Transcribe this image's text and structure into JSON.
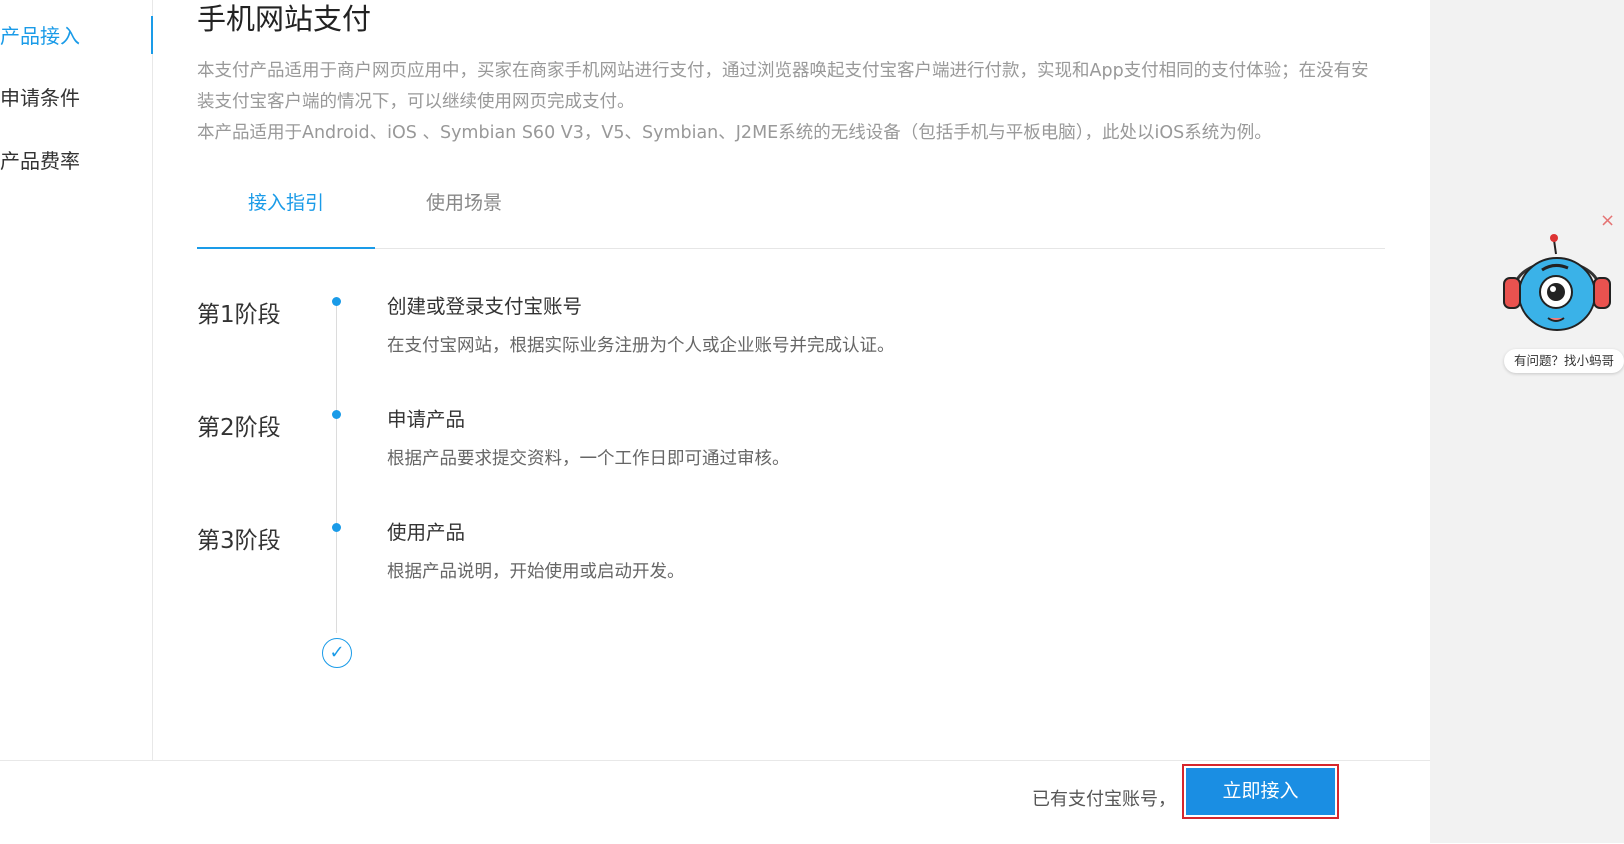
{
  "sidebar": {
    "items": [
      {
        "label": "产品接入",
        "active": true
      },
      {
        "label": "申请条件",
        "active": false
      },
      {
        "label": "产品费率",
        "active": false
      }
    ]
  },
  "main": {
    "title": "手机网站支付",
    "description_lines": [
      "本支付产品适用于商户网页应用中，买家在商家手机网站进行支付，通过浏览器唤起支付宝客户端进行付款，实现和App支付相同的支付体验；在没有安",
      "装支付宝客户端的情况下，可以继续使用网页完成支付。",
      "本产品适用于Android、iOS 、Symbian S60 V3，V5、Symbian、J2ME系统的无线设备（包括手机与平板电脑），此处以iOS系统为例。"
    ],
    "tabs": [
      {
        "label": "接入指引",
        "active": true
      },
      {
        "label": "使用场景",
        "active": false
      }
    ],
    "stages": [
      {
        "label": "第1阶段",
        "title": "创建或登录支付宝账号",
        "desc": "在支付宝网站，根据实际业务注册为个人或企业账号并完成认证。"
      },
      {
        "label": "第2阶段",
        "title": "申请产品",
        "desc": "根据产品要求提交资料，一个工作日即可通过审核。"
      },
      {
        "label": "第3阶段",
        "title": "使用产品",
        "desc": "根据产品说明，开始使用或启动开发。"
      }
    ],
    "complete_icon": "check-circle-icon",
    "complete_glyph": "✓"
  },
  "footer": {
    "has_account_text": "已有支付宝账号，",
    "cta_label": "立即接入"
  },
  "helper": {
    "caption": "有问题？找小蚂哥",
    "close_glyph": "×",
    "icon": "robot-mascot-icon"
  },
  "colors": {
    "accent": "#1a9be8",
    "cta": "#1a8ee3",
    "highlight_outline": "#d6262c",
    "right_panel": "#f2f2f2"
  }
}
